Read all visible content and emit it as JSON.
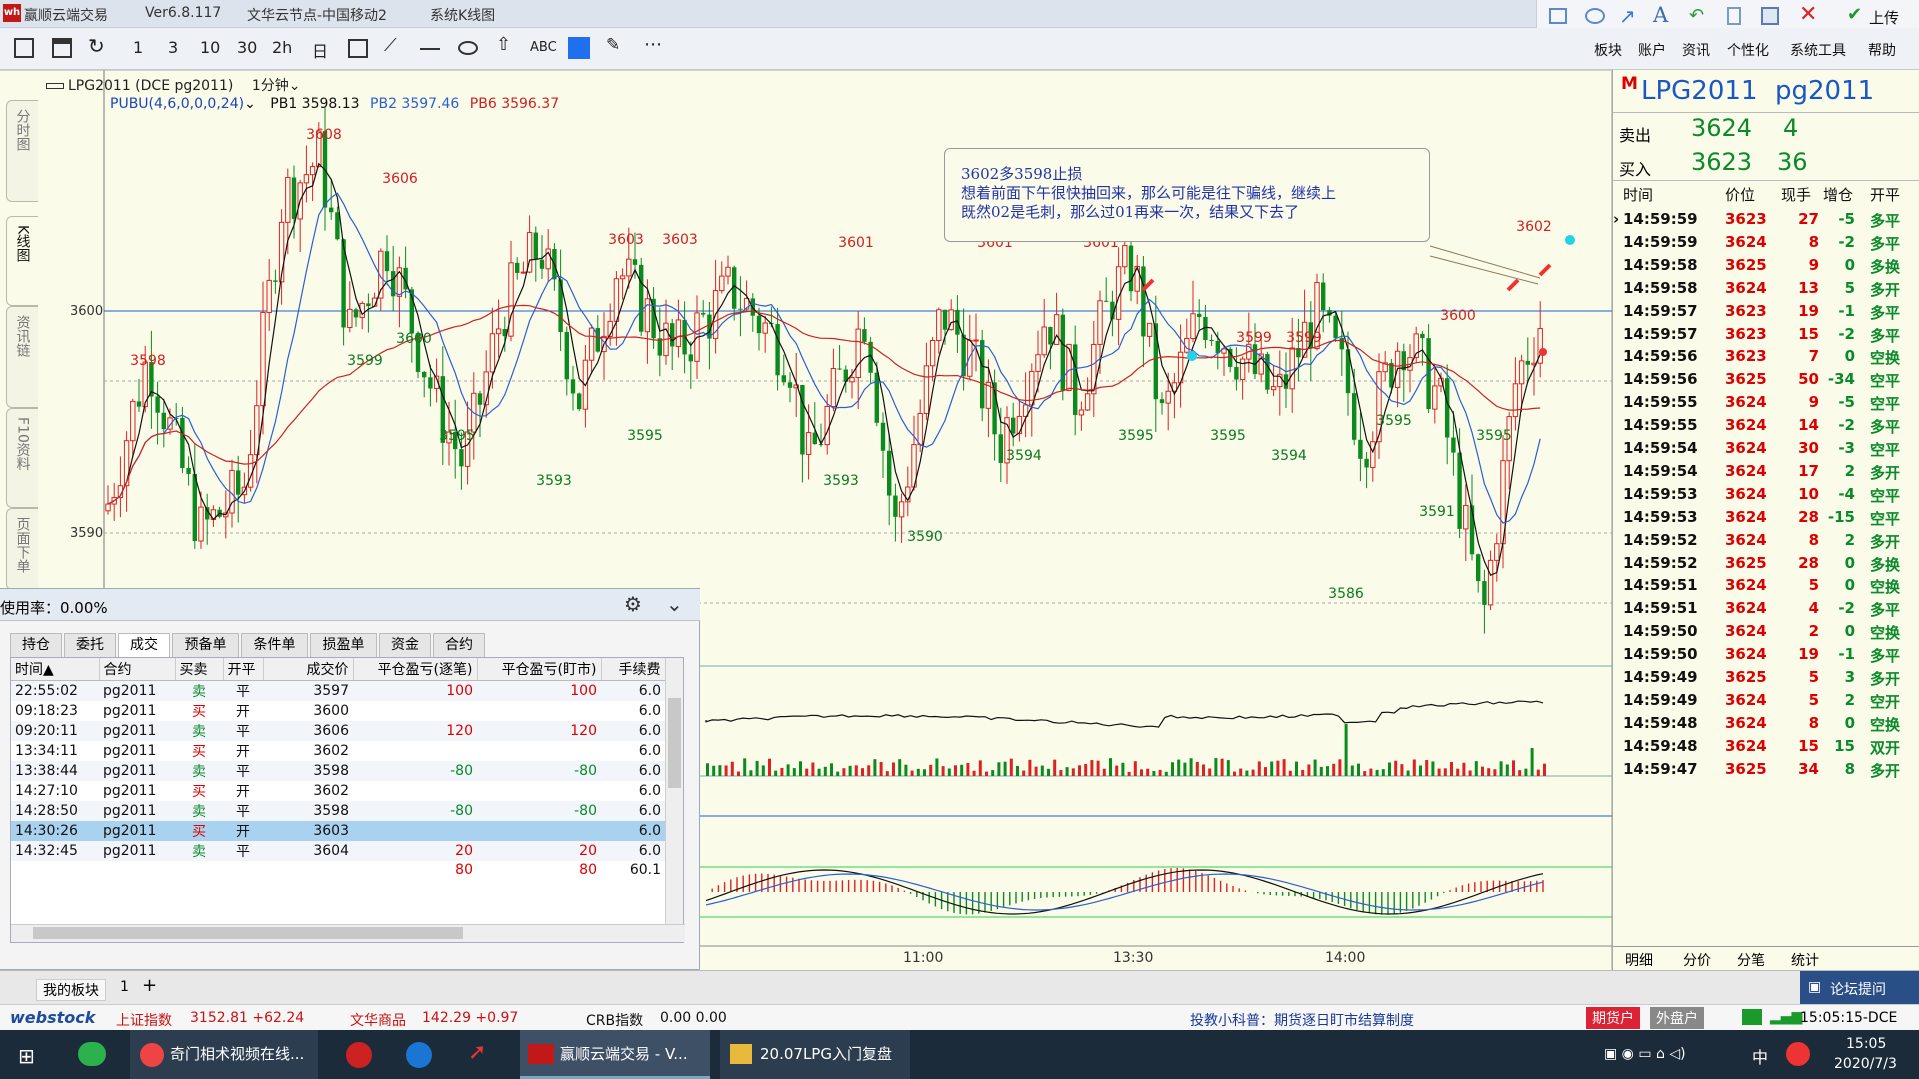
{
  "window": {
    "app": "赢顺云端交易",
    "version": "Ver6.8.117",
    "node": "文华云节点-中国移动2",
    "view": "系统K线图"
  },
  "top_actions": {
    "upload": "上传"
  },
  "toolbar": {
    "items": [
      "1",
      "3",
      "10",
      "30",
      "2h",
      "日",
      "ABC"
    ],
    "menus": [
      "板块",
      "账户",
      "资讯",
      "个性化",
      "系统工具",
      "帮助"
    ]
  },
  "side_tabs": [
    "分时图",
    "K线图",
    "资讯链",
    "F10资料",
    "页面下单"
  ],
  "chart": {
    "header": {
      "contract": "LPG2011 (DCE pg2011)",
      "period": "1分钟",
      "indicator": "PUBU(4,6,0,0,0,24)",
      "pb1": "PB1 3598.13",
      "pb2": "PB2 3597.46",
      "pb6": "PB6 3596.37"
    },
    "note": [
      "3602多3598止损",
      "想着前面下午很快抽回来，那么可能是往下骗线，继续上",
      "既然02是毛刺，那么过01再来一次，结果又下去了"
    ],
    "y_labels": [
      "3600",
      "3590"
    ],
    "x_labels": [
      "11:00",
      "13:30",
      "14:00"
    ],
    "high_labels": [
      "3598",
      "3608",
      "3606",
      "3603",
      "3603",
      "3601",
      "3601",
      "3601",
      "3602",
      "3599",
      "3599",
      "3600",
      "3602"
    ],
    "low_labels": [
      "3599",
      "3600",
      "3595",
      "3593",
      "3595",
      "3593",
      "3590",
      "3594",
      "3595",
      "3595",
      "3594",
      "3586",
      "3595",
      "3591",
      "3595"
    ]
  },
  "quote": {
    "code_icon": "M",
    "name": "LPG2011",
    "code": "pg2011",
    "sell_label": "卖出",
    "sell_price": "3624",
    "sell_vol": "4",
    "buy_label": "买入",
    "buy_price": "3623",
    "buy_vol": "36",
    "headers": [
      "时间",
      "价位",
      "现手",
      "增仓",
      "开平"
    ],
    "rows": [
      [
        "14:59:59",
        "3623",
        "27",
        "-5",
        "多平"
      ],
      [
        "14:59:59",
        "3624",
        "8",
        "-2",
        "多平"
      ],
      [
        "14:59:58",
        "3625",
        "9",
        "0",
        "多换"
      ],
      [
        "14:59:58",
        "3624",
        "13",
        "5",
        "多开"
      ],
      [
        "14:59:57",
        "3623",
        "19",
        "-1",
        "多平"
      ],
      [
        "14:59:57",
        "3623",
        "15",
        "-2",
        "多平"
      ],
      [
        "14:59:56",
        "3623",
        "7",
        "0",
        "空换"
      ],
      [
        "14:59:56",
        "3625",
        "50",
        "-34",
        "空平"
      ],
      [
        "14:59:55",
        "3624",
        "9",
        "-5",
        "空平"
      ],
      [
        "14:59:55",
        "3624",
        "14",
        "-2",
        "多平"
      ],
      [
        "14:59:54",
        "3624",
        "30",
        "-3",
        "空平"
      ],
      [
        "14:59:54",
        "3624",
        "17",
        "2",
        "多开"
      ],
      [
        "14:59:53",
        "3624",
        "10",
        "-4",
        "空平"
      ],
      [
        "14:59:53",
        "3624",
        "28",
        "-15",
        "空平"
      ],
      [
        "14:59:52",
        "3624",
        "8",
        "2",
        "多开"
      ],
      [
        "14:59:52",
        "3625",
        "28",
        "0",
        "多换"
      ],
      [
        "14:59:51",
        "3624",
        "5",
        "0",
        "空换"
      ],
      [
        "14:59:51",
        "3624",
        "4",
        "-2",
        "多平"
      ],
      [
        "14:59:50",
        "3624",
        "2",
        "0",
        "空换"
      ],
      [
        "14:59:50",
        "3624",
        "19",
        "-1",
        "多平"
      ],
      [
        "14:59:49",
        "3625",
        "5",
        "3",
        "多开"
      ],
      [
        "14:59:49",
        "3624",
        "5",
        "2",
        "空开"
      ],
      [
        "14:59:48",
        "3624",
        "8",
        "0",
        "空换"
      ],
      [
        "14:59:48",
        "3624",
        "15",
        "15",
        "双开"
      ],
      [
        "14:59:47",
        "3625",
        "34",
        "8",
        "多开"
      ]
    ],
    "tabs": [
      "明细",
      "分价",
      "分笔",
      "统计"
    ]
  },
  "order_panel": {
    "usage": "使用率：0.00%",
    "tabs": [
      "持仓",
      "委托",
      "成交",
      "预备单",
      "条件单",
      "损盈单",
      "资金",
      "合约"
    ],
    "active_tab": "成交",
    "headers": [
      "时间▲",
      "合约",
      "买卖",
      "开平",
      "成交价",
      "平仓盈亏(逐笔)",
      "平仓盈亏(盯市)",
      "手续费"
    ],
    "rows": [
      [
        "22:55:02",
        "pg2011",
        "卖",
        "平",
        "3597",
        "100",
        "100",
        "6.0"
      ],
      [
        "09:18:23",
        "pg2011",
        "买",
        "开",
        "3600",
        "",
        "",
        "6.0"
      ],
      [
        "09:20:11",
        "pg2011",
        "卖",
        "平",
        "3606",
        "120",
        "120",
        "6.0"
      ],
      [
        "13:34:11",
        "pg2011",
        "买",
        "开",
        "3602",
        "",
        "",
        "6.0"
      ],
      [
        "13:38:44",
        "pg2011",
        "卖",
        "平",
        "3598",
        "-80",
        "-80",
        "6.0"
      ],
      [
        "14:27:10",
        "pg2011",
        "买",
        "开",
        "3602",
        "",
        "",
        "6.0"
      ],
      [
        "14:28:50",
        "pg2011",
        "卖",
        "平",
        "3598",
        "-80",
        "-80",
        "6.0"
      ],
      [
        "14:30:26",
        "pg2011",
        "买",
        "开",
        "3603",
        "",
        "",
        "6.0"
      ],
      [
        "14:32:45",
        "pg2011",
        "卖",
        "平",
        "3604",
        "20",
        "20",
        "6.0"
      ],
      [
        "",
        "",
        "",
        "",
        "",
        "80",
        "80",
        "60.1"
      ]
    ]
  },
  "bottom": {
    "my_block": "我的板块",
    "block_count": "1",
    "add": "+",
    "forum": "论坛提问"
  },
  "ticker": {
    "brand": "webstock",
    "sh_label": "上证指数",
    "sh_value": "3152.81 +62.24",
    "wh_label": "文华商品",
    "wh_value": "142.29 +0.97",
    "crb_label": "CRB指数",
    "crb_value": "0.00 0.00",
    "tip": "投教小科普：期货逐日盯市结算制度",
    "futures_btn": "期货户",
    "foreign_btn": "外盘户",
    "clock": "15:05:15-DCE"
  },
  "taskbar": {
    "apps": [
      "奇门相术视频在线...",
      "赢顺云端交易 - V...",
      "20.07LPG入门复盘"
    ],
    "ime": "中",
    "time": "15:05",
    "date": "2020/7/3"
  }
}
